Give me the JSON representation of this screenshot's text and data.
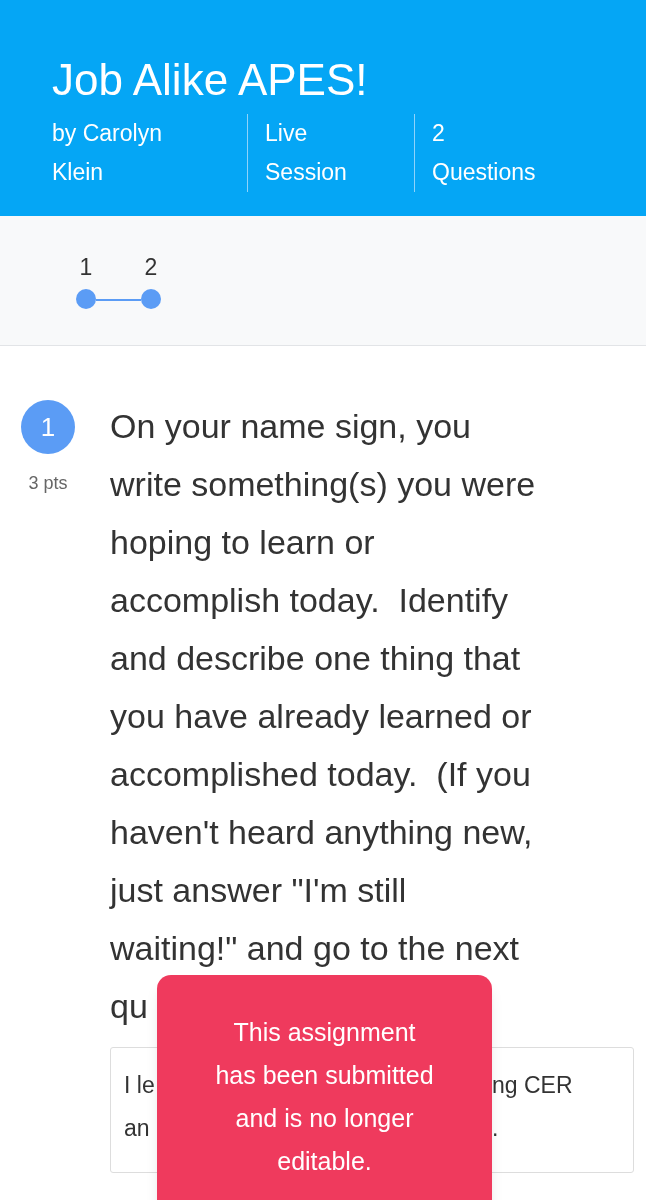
{
  "header": {
    "title": "Job Alike APES!",
    "meta": [
      [
        "by Carolyn",
        "Klein"
      ],
      [
        "Live",
        "Session"
      ],
      [
        "2",
        "Questions"
      ]
    ]
  },
  "steps": [
    {
      "label": "1",
      "selected": true
    },
    {
      "label": "2",
      "selected": true
    }
  ],
  "question": {
    "number": "1",
    "points": "3 pts",
    "lines": [
      "On your name sign, you",
      "write something(s) you were",
      "hoping to learn or",
      "accomplish today.  Identify",
      "and describe one thing that",
      "you have already learned or",
      "accomplished today.  (If you",
      "haven't heard anything new,",
      "just answer \"I'm still",
      "waiting!\" and go to the next",
      "qu"
    ],
    "answer": {
      "left_lines": [
        "I le",
        "an"
      ],
      "right_lines": [
        "ng CER",
        "."
      ]
    }
  },
  "toast": {
    "lines": [
      "This assignment",
      "has been submitted",
      "and is no longer",
      "editable."
    ]
  }
}
